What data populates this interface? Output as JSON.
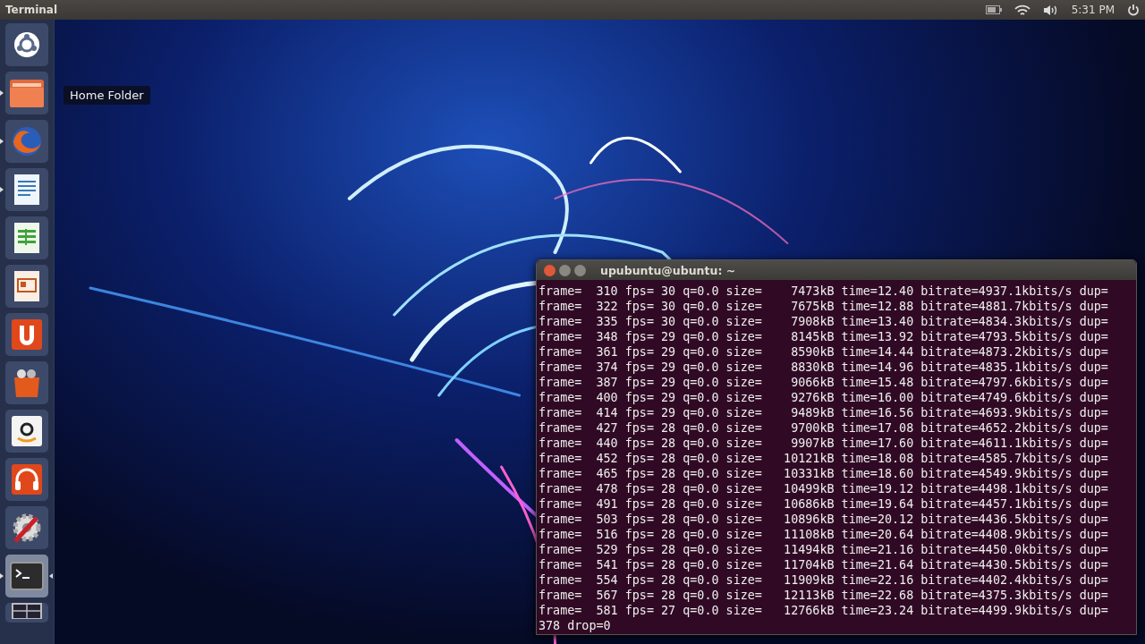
{
  "top_panel": {
    "app_title": "Terminal",
    "clock": "5:31 PM"
  },
  "launcher": [
    {
      "kind": "dash",
      "running": false,
      "active": false
    },
    {
      "kind": "folder",
      "running": true,
      "active": false
    },
    {
      "kind": "browser",
      "running": true,
      "active": false
    },
    {
      "kind": "writer",
      "running": true,
      "active": false
    },
    {
      "kind": "calc",
      "running": false,
      "active": false
    },
    {
      "kind": "impress",
      "running": false,
      "active": false
    },
    {
      "kind": "ubuntu-one",
      "running": false,
      "active": false
    },
    {
      "kind": "software-center",
      "running": false,
      "active": false
    },
    {
      "kind": "amazon",
      "running": false,
      "active": false
    },
    {
      "kind": "music",
      "running": false,
      "active": false
    },
    {
      "kind": "settings",
      "running": false,
      "active": false
    },
    {
      "kind": "terminal",
      "running": true,
      "active": true
    },
    {
      "kind": "workspaces",
      "running": false,
      "active": false
    }
  ],
  "tooltip": "Home Folder",
  "terminal": {
    "title": "upubuntu@ubuntu: ~",
    "lines": [
      "frame=  310 fps= 30 q=0.0 size=    7473kB time=12.40 bitrate=4937.1kbits/s dup=",
      "frame=  322 fps= 30 q=0.0 size=    7675kB time=12.88 bitrate=4881.7kbits/s dup=",
      "frame=  335 fps= 30 q=0.0 size=    7908kB time=13.40 bitrate=4834.3kbits/s dup=",
      "frame=  348 fps= 29 q=0.0 size=    8145kB time=13.92 bitrate=4793.5kbits/s dup=",
      "frame=  361 fps= 29 q=0.0 size=    8590kB time=14.44 bitrate=4873.2kbits/s dup=",
      "frame=  374 fps= 29 q=0.0 size=    8830kB time=14.96 bitrate=4835.1kbits/s dup=",
      "frame=  387 fps= 29 q=0.0 size=    9066kB time=15.48 bitrate=4797.6kbits/s dup=",
      "frame=  400 fps= 29 q=0.0 size=    9276kB time=16.00 bitrate=4749.6kbits/s dup=",
      "frame=  414 fps= 29 q=0.0 size=    9489kB time=16.56 bitrate=4693.9kbits/s dup=",
      "frame=  427 fps= 28 q=0.0 size=    9700kB time=17.08 bitrate=4652.2kbits/s dup=",
      "frame=  440 fps= 28 q=0.0 size=    9907kB time=17.60 bitrate=4611.1kbits/s dup=",
      "frame=  452 fps= 28 q=0.0 size=   10121kB time=18.08 bitrate=4585.7kbits/s dup=",
      "frame=  465 fps= 28 q=0.0 size=   10331kB time=18.60 bitrate=4549.9kbits/s dup=",
      "frame=  478 fps= 28 q=0.0 size=   10499kB time=19.12 bitrate=4498.1kbits/s dup=",
      "frame=  491 fps= 28 q=0.0 size=   10686kB time=19.64 bitrate=4457.1kbits/s dup=",
      "frame=  503 fps= 28 q=0.0 size=   10896kB time=20.12 bitrate=4436.5kbits/s dup=",
      "frame=  516 fps= 28 q=0.0 size=   11108kB time=20.64 bitrate=4408.9kbits/s dup=",
      "frame=  529 fps= 28 q=0.0 size=   11494kB time=21.16 bitrate=4450.0kbits/s dup=",
      "frame=  541 fps= 28 q=0.0 size=   11704kB time=21.64 bitrate=4430.5kbits/s dup=",
      "frame=  554 fps= 28 q=0.0 size=   11909kB time=22.16 bitrate=4402.4kbits/s dup=",
      "frame=  567 fps= 28 q=0.0 size=   12113kB time=22.68 bitrate=4375.3kbits/s dup=",
      "frame=  581 fps= 27 q=0.0 size=   12766kB time=23.24 bitrate=4499.9kbits/s dup=",
      "378 drop=0"
    ]
  }
}
